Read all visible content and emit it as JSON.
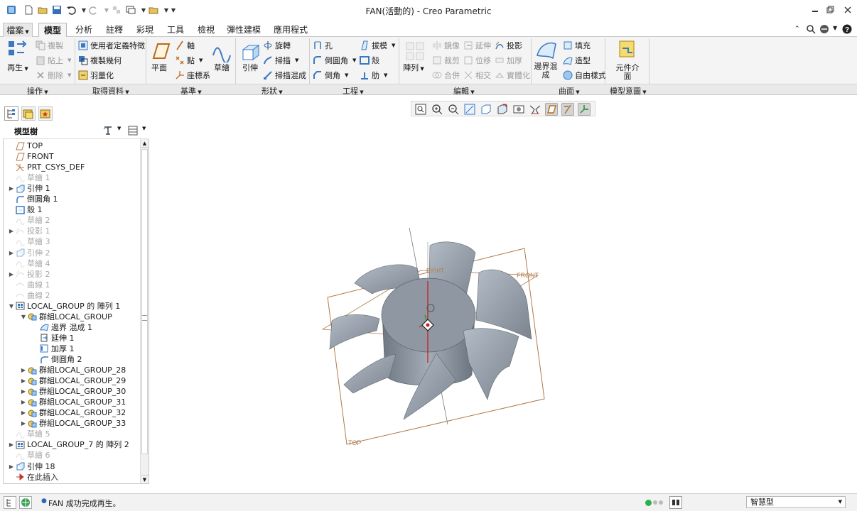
{
  "window": {
    "title": "FAN(活動的) - Creo Parametric"
  },
  "quick_access": [
    "new-icon",
    "open-icon",
    "save-icon",
    "undo-icon",
    "redo-icon",
    "regenerate-icon",
    "windows-icon",
    "more-icon"
  ],
  "tabs": [
    {
      "label": "檔案",
      "dropdown": true
    },
    {
      "label": "模型",
      "active": true
    },
    {
      "label": "分析"
    },
    {
      "label": "註釋"
    },
    {
      "label": "彩現"
    },
    {
      "label": "工具"
    },
    {
      "label": "檢視"
    },
    {
      "label": "彈性建模"
    },
    {
      "label": "應用程式"
    }
  ],
  "ribbon": {
    "operations": {
      "regenerate": "再生",
      "copy": "複製",
      "paste": "貼上",
      "delete": "刪除",
      "group_label": "操作"
    },
    "get_data": {
      "udf": "使用者定義特徵",
      "copy_geom": "複製幾何",
      "shrinkwrap": "羽量化",
      "group_label": "取得資料"
    },
    "datum": {
      "plane": "平面",
      "axis": "軸",
      "point": "點",
      "csys": "座標系",
      "sketch": "草繪",
      "group_label": "基準"
    },
    "shapes": {
      "extrude": "引伸",
      "revolve": "旋轉",
      "sweep": "掃描",
      "swept_blend": "掃描混成",
      "group_label": "形狀"
    },
    "engineering": {
      "hole": "孔",
      "round": "倒圓角",
      "chamfer": "倒角",
      "draft": "拔模",
      "shell": "殼",
      "rib": "肋",
      "group_label": "工程"
    },
    "editing": {
      "pattern": "陣列",
      "mirror": "鏡像",
      "extend": "延伸",
      "project": "投影",
      "trim": "裁剪",
      "offset": "位移",
      "thicken": "加厚",
      "merge": "合併",
      "intersect": "相交",
      "solidify": "實體化",
      "group_label": "編輯"
    },
    "surfaces": {
      "boundary_blend": "邊界混成",
      "fill": "填充",
      "style": "造型",
      "freestyle": "自由樣式",
      "group_label": "曲面"
    },
    "model_intent": {
      "component_interface": "元件介面",
      "group_label": "模型意圖"
    }
  },
  "model_tree": {
    "title": "模型樹",
    "items": [
      {
        "label": "TOP",
        "icon": "datum-plane-icon",
        "level": 0,
        "dim": false,
        "expand": ""
      },
      {
        "label": "FRONT",
        "icon": "datum-plane-icon",
        "level": 0,
        "dim": false,
        "expand": ""
      },
      {
        "label": "PRT_CSYS_DEF",
        "icon": "csys-icon",
        "level": 0,
        "dim": false,
        "expand": ""
      },
      {
        "label": "草繪 1",
        "icon": "sketch-icon",
        "level": 0,
        "dim": true,
        "expand": ""
      },
      {
        "label": "引伸 1",
        "icon": "extrude-icon",
        "level": 0,
        "dim": false,
        "expand": "▶"
      },
      {
        "label": "倒圓角 1",
        "icon": "round-icon",
        "level": 0,
        "dim": false,
        "expand": ""
      },
      {
        "label": "殼 1",
        "icon": "shell-icon",
        "level": 0,
        "dim": false,
        "expand": ""
      },
      {
        "label": "草繪 2",
        "icon": "sketch-icon",
        "level": 0,
        "dim": true,
        "expand": ""
      },
      {
        "label": "投影 1",
        "icon": "project-icon",
        "level": 0,
        "dim": true,
        "expand": "▶"
      },
      {
        "label": "草繪 3",
        "icon": "sketch-icon",
        "level": 0,
        "dim": true,
        "expand": ""
      },
      {
        "label": "引伸 2",
        "icon": "extrude-icon",
        "level": 0,
        "dim": true,
        "expand": "▶"
      },
      {
        "label": "草繪 4",
        "icon": "sketch-icon",
        "level": 0,
        "dim": true,
        "expand": ""
      },
      {
        "label": "投影 2",
        "icon": "project-icon",
        "level": 0,
        "dim": true,
        "expand": "▶"
      },
      {
        "label": "曲線 1",
        "icon": "curve-icon",
        "level": 0,
        "dim": true,
        "expand": ""
      },
      {
        "label": "曲線 2",
        "icon": "curve-icon",
        "level": 0,
        "dim": true,
        "expand": ""
      },
      {
        "label": "LOCAL_GROUP 的 陣列 1",
        "icon": "pattern-icon",
        "level": 0,
        "dim": false,
        "expand": "▼"
      },
      {
        "label": "群組LOCAL_GROUP",
        "icon": "group-icon",
        "level": 1,
        "dim": false,
        "expand": "▼"
      },
      {
        "label": "邊界 混成 1",
        "icon": "boundary-blend-icon",
        "level": 2,
        "dim": false,
        "expand": ""
      },
      {
        "label": "延伸 1",
        "icon": "extend-icon",
        "level": 2,
        "dim": false,
        "expand": ""
      },
      {
        "label": "加厚 1",
        "icon": "thicken-icon",
        "level": 2,
        "dim": false,
        "expand": ""
      },
      {
        "label": "倒圓角 2",
        "icon": "round-icon",
        "level": 2,
        "dim": false,
        "expand": ""
      },
      {
        "label": "群組LOCAL_GROUP_28",
        "icon": "group-icon",
        "level": 1,
        "dim": false,
        "expand": "▶"
      },
      {
        "label": "群組LOCAL_GROUP_29",
        "icon": "group-icon",
        "level": 1,
        "dim": false,
        "expand": "▶"
      },
      {
        "label": "群組LOCAL_GROUP_30",
        "icon": "group-icon",
        "level": 1,
        "dim": false,
        "expand": "▶"
      },
      {
        "label": "群組LOCAL_GROUP_31",
        "icon": "group-icon",
        "level": 1,
        "dim": false,
        "expand": "▶"
      },
      {
        "label": "群組LOCAL_GROUP_32",
        "icon": "group-icon",
        "level": 1,
        "dim": false,
        "expand": "▶"
      },
      {
        "label": "群組LOCAL_GROUP_33",
        "icon": "group-icon",
        "level": 1,
        "dim": false,
        "expand": "▶"
      },
      {
        "label": "草繪 5",
        "icon": "sketch-icon",
        "level": 0,
        "dim": true,
        "expand": ""
      },
      {
        "label": "LOCAL_GROUP_7 的 陣列 2",
        "icon": "pattern-icon",
        "level": 0,
        "dim": false,
        "expand": "▶"
      },
      {
        "label": "草繪 6",
        "icon": "sketch-icon",
        "level": 0,
        "dim": true,
        "expand": ""
      },
      {
        "label": "引伸 18",
        "icon": "extrude-icon",
        "level": 0,
        "dim": false,
        "expand": "▶"
      },
      {
        "label": "在此插入",
        "icon": "insert-here-icon",
        "level": 0,
        "dim": false,
        "expand": ""
      }
    ]
  },
  "viewport": {
    "datum_labels": {
      "front": "FRONT",
      "top": "TOP",
      "right": "RIGHT"
    }
  },
  "status": {
    "message": "FAN 成功完成再生。",
    "filter": "智慧型"
  },
  "colors": {
    "datum_plane": "#b07a4a",
    "part_shade": "#8f98a2",
    "part_light": "#b5bec8",
    "axis_gray": "#7a7a7a"
  }
}
